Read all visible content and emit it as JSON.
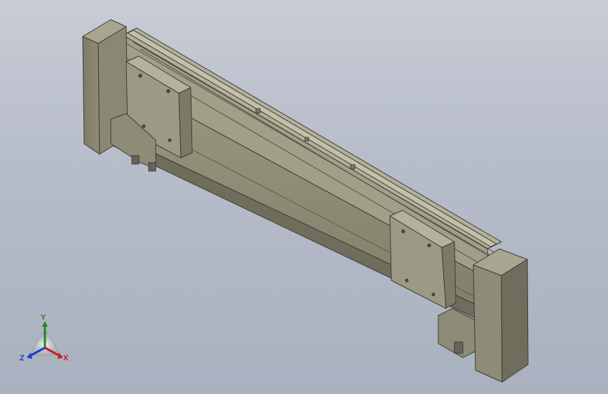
{
  "viewport": {
    "background_top": "#c7ccd6",
    "background_bottom": "#a9b0bf",
    "model_color": "#8c8a74",
    "model_dark": "#6f6d5c",
    "model_light": "#a5a38d"
  },
  "triad": {
    "x_label": "X",
    "y_label": "Y",
    "z_label": "Z",
    "x_color": "#c81e1e",
    "y_color": "#1a8a1a",
    "z_color": "#1e3cc8"
  }
}
